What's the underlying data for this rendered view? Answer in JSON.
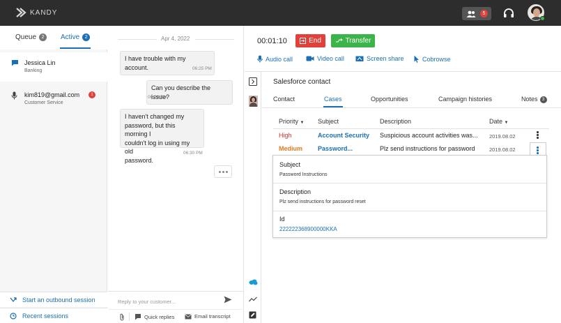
{
  "app": {
    "brand": "KANDY"
  },
  "topbar": {
    "team_count": "5"
  },
  "sessions": {
    "tabs": [
      {
        "label": "Queue",
        "count": "2"
      },
      {
        "label": "Active",
        "count": "2"
      }
    ],
    "items": [
      {
        "name": "Jessica Lin",
        "sub": "Banking",
        "channel": "chat-icon",
        "unread": ""
      },
      {
        "name": "kim819@gmail.com",
        "sub": "Customer Service",
        "channel": "microphone-icon",
        "unread": "1"
      }
    ],
    "links": {
      "outbound": "Start an outbound session",
      "recent": "Recent sessions"
    }
  },
  "chat": {
    "date": "Apr 4, 2022",
    "messages": [
      {
        "text": "I have trouble with my account.",
        "time": "06:25 PM",
        "side": "customer"
      },
      {
        "text": "Can you describe the issue?",
        "time": "06:26 PM",
        "side": "agent"
      },
      {
        "lines": [
          "I haven't changed my",
          "password, but this morning I",
          "couldn't log in using my old",
          "password."
        ],
        "time": "06:30 PM",
        "side": "customer"
      }
    ],
    "composer": {
      "placeholder": "Reply to your customer...",
      "value": ""
    },
    "tools": {
      "quick_replies": "Quick replies",
      "email_transcript": "Email transcript"
    }
  },
  "call": {
    "timer": "00:01:10",
    "end_label": "End",
    "transfer_label": "Transfer",
    "actions": [
      "Audio call",
      "Video call",
      "Screen share",
      "Cobrowse"
    ]
  },
  "salesforce": {
    "title": "Salesforce contact",
    "tabs": [
      "Contact",
      "Cases",
      "Opportunities",
      "Campaign histories",
      "Notes"
    ],
    "active_tab": "Cases",
    "notes_count": "3",
    "columns": [
      "Priority",
      "Subject",
      "Description",
      "Date"
    ],
    "rows": [
      {
        "priority": "High",
        "subject": "Account Security",
        "description": "Suspicious account activities was...",
        "date": "2019.08.02"
      },
      {
        "priority": "Medium",
        "subject": "Password...",
        "description": "Plz send instructions for password",
        "date": "2019.08.02"
      }
    ],
    "detail": {
      "subject_label": "Subject",
      "subject_value": "Password Instructions",
      "description_label": "Description",
      "description_value": "Plz send instructions for password reset",
      "id_label": "Id",
      "id_value": "222222368900000KKA"
    }
  },
  "colors": {
    "accent": "#1a6fb5",
    "end": "#e0413a",
    "transfer": "#3bb54a",
    "priority_high": "#d9342b",
    "priority_medium": "#e07b1f"
  }
}
